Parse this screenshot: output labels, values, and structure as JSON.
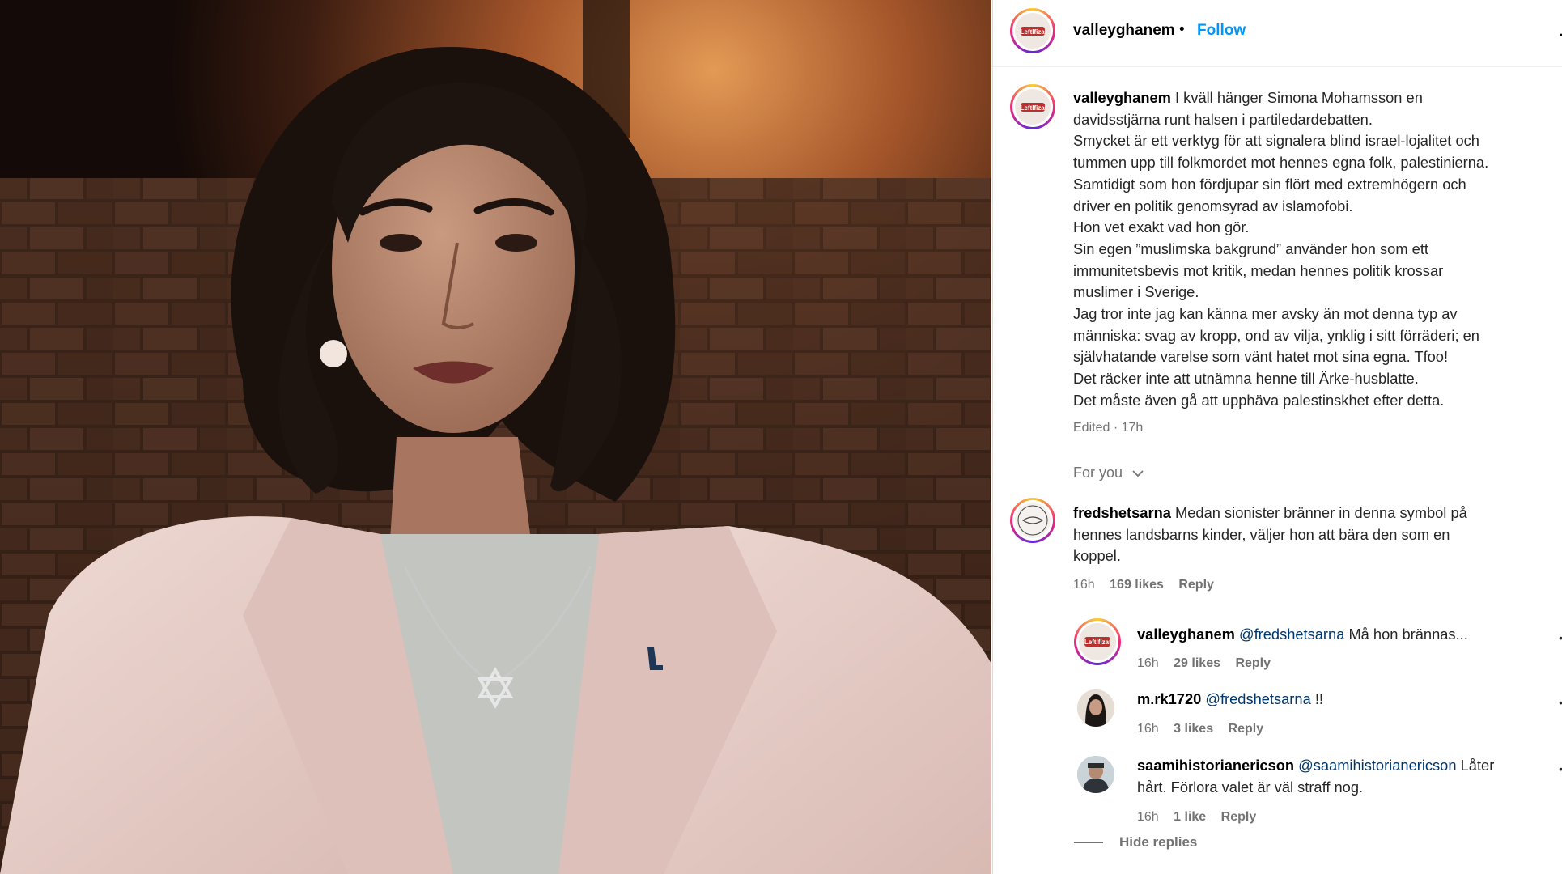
{
  "post": {
    "username": "valleyghanem",
    "follow_label": "Follow",
    "caption_lines": [
      "I kväll hänger Simona Mohamsson en",
      "davidsstjärna runt halsen i partiledardebatten.",
      "Smycket är ett verktyg för att signalera blind israel-lojalitet och",
      "tummen upp till folkmordet mot hennes egna folk, palestinierna.",
      "Samtidigt som hon fördjupar sin flört med extremhögern och",
      "driver en politik genomsyrad av islamofobi.",
      "Hon vet exakt vad hon gör.",
      "Sin egen ”muslimska bakgrund” använder hon som ett",
      "immunitetsbevis mot kritik, medan hennes politik krossar",
      "muslimer i Sverige.",
      "Jag tror inte jag kan känna mer avsky än mot denna typ av",
      "människa: svag av kropp, ond av vilja, ynklig i sitt förräderi; en",
      "självhatande varelse som vänt hatet mot sina egna. Tfoo!",
      "Det räcker inte att utnämna henne till Ärke-husblatte.",
      "Det måste även gå att upphäva palestinskhet efter detta."
    ],
    "edited_label": "Edited · 17h",
    "for_you_label": "For you"
  },
  "comments": [
    {
      "username": "fredshetsarna",
      "text_lines": [
        "Medan sionister bränner in denna symbol på",
        "hennes landsbarns kinder, väljer hon att bära den som en",
        "koppel."
      ],
      "time": "16h",
      "likes": "169 likes",
      "reply": "Reply"
    },
    {
      "username": "valleyghanem",
      "mention": "@fredshetsarna",
      "text": "Må hon brännas...",
      "time": "16h",
      "likes": "29 likes",
      "reply": "Reply"
    },
    {
      "username": "m.rk1720",
      "mention": "@fredshetsarna",
      "text": "!!",
      "time": "16h",
      "likes": "3 likes",
      "reply": "Reply"
    },
    {
      "username": "saamihistorianericson",
      "mention": "@saamihistorianericson",
      "text": "Låter",
      "text_line2": "hårt. Förlora valet är väl straff nog.",
      "time": "16h",
      "likes": "1 like",
      "reply": "Reply"
    }
  ],
  "hide_replies_label": "Hide replies",
  "avatar_badge_text": "Leftlfizatro",
  "colors": {
    "follow": "#0095f6",
    "mention": "#00376b",
    "secondary_text": "#737373",
    "blazer": "#e7cfca"
  },
  "icons": {
    "more": "more-icon",
    "chevron": "chevron-down-icon",
    "comment_options": "more-dots-icon"
  }
}
